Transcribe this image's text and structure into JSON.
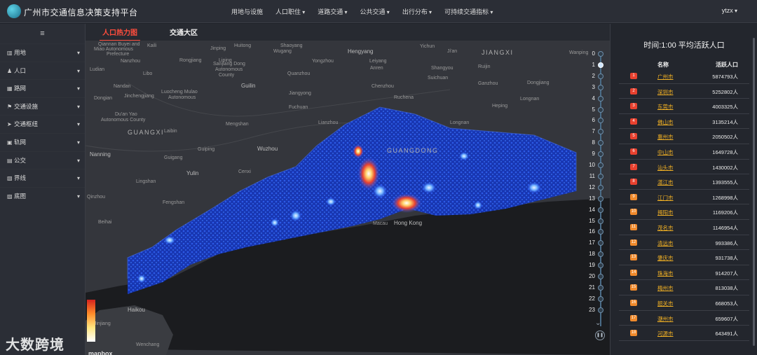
{
  "header": {
    "title": "广州市交通信息决策支持平台",
    "nav": [
      {
        "label": "用地与设施",
        "caret": false
      },
      {
        "label": "人口职住",
        "caret": true
      },
      {
        "label": "道路交通",
        "caret": true
      },
      {
        "label": "公共交通",
        "caret": true
      },
      {
        "label": "出行分布",
        "caret": true
      },
      {
        "label": "可持续交通指标",
        "caret": true
      }
    ],
    "user": "ytzx"
  },
  "sidebar": {
    "menu_icon": "menu-icon",
    "items": [
      {
        "label": "用地",
        "icon": "bar-chart-icon",
        "glyph": "▥"
      },
      {
        "label": "人口",
        "icon": "user-icon",
        "glyph": "♟"
      },
      {
        "label": "路网",
        "icon": "road-icon",
        "glyph": "▦"
      },
      {
        "label": "交通设施",
        "icon": "signpost-icon",
        "glyph": "⚑"
      },
      {
        "label": "交通枢纽",
        "icon": "navigation-icon",
        "glyph": "➤"
      },
      {
        "label": "轨网",
        "icon": "train-icon",
        "glyph": "▣"
      },
      {
        "label": "公交",
        "icon": "bus-icon",
        "glyph": "▤"
      },
      {
        "label": "界线",
        "icon": "boundary-icon",
        "glyph": "▧"
      },
      {
        "label": "底图",
        "icon": "basemap-icon",
        "glyph": "▨"
      }
    ]
  },
  "tabs": [
    {
      "label": "人口热力图",
      "active": true
    },
    {
      "label": "交通大区",
      "active": false
    }
  ],
  "map": {
    "labels": [
      {
        "text": "Qiannan Buyei and",
        "cls": ""
      },
      {
        "text": "Miao Autonomous",
        "cls": ""
      },
      {
        "text": "Prefecture",
        "cls": ""
      },
      {
        "text": "Kaili",
        "cls": ""
      },
      {
        "text": "Jinping",
        "cls": ""
      },
      {
        "text": "Huitong",
        "cls": ""
      },
      {
        "text": "Shaoyang",
        "cls": ""
      },
      {
        "text": "Wugang",
        "cls": ""
      },
      {
        "text": "Hengyang",
        "cls": "mid"
      },
      {
        "text": "Yichun",
        "cls": ""
      },
      {
        "text": "Ji'an",
        "cls": ""
      },
      {
        "text": "JIANGXI",
        "cls": "big"
      },
      {
        "text": "Wanping",
        "cls": ""
      },
      {
        "text": "Nanzhou",
        "cls": ""
      },
      {
        "text": "Rongjiang",
        "cls": ""
      },
      {
        "text": "Liping",
        "cls": ""
      },
      {
        "text": "Yongzhou",
        "cls": ""
      },
      {
        "text": "Leiyang",
        "cls": ""
      },
      {
        "text": "Anren",
        "cls": ""
      },
      {
        "text": "Shangyou",
        "cls": ""
      },
      {
        "text": "Ruijin",
        "cls": ""
      },
      {
        "text": "Ludian",
        "cls": ""
      },
      {
        "text": "Libo",
        "cls": ""
      },
      {
        "text": "Sanjiang Dong",
        "cls": ""
      },
      {
        "text": "Autonomous",
        "cls": ""
      },
      {
        "text": "County",
        "cls": ""
      },
      {
        "text": "Quanzhou",
        "cls": ""
      },
      {
        "text": "Guilin",
        "cls": "mid"
      },
      {
        "text": "Chenzhou",
        "cls": ""
      },
      {
        "text": "Suichuan",
        "cls": ""
      },
      {
        "text": "Ganzhou",
        "cls": ""
      },
      {
        "text": "Nandan",
        "cls": ""
      },
      {
        "text": "Luocheng Mulao",
        "cls": ""
      },
      {
        "text": "Jiangyong",
        "cls": ""
      },
      {
        "text": "Dongjiang",
        "cls": ""
      },
      {
        "text": "Longnan",
        "cls": ""
      },
      {
        "text": "Dongian",
        "cls": ""
      },
      {
        "text": "Jinchengjiang",
        "cls": ""
      },
      {
        "text": "Autonomous",
        "cls": ""
      },
      {
        "text": "Fuchuan",
        "cls": ""
      },
      {
        "text": "Ruchena",
        "cls": ""
      },
      {
        "text": "Heping",
        "cls": ""
      },
      {
        "text": "Du'an Yao",
        "cls": ""
      },
      {
        "text": "Autonomous County",
        "cls": ""
      },
      {
        "text": "Mengshan",
        "cls": ""
      },
      {
        "text": "Lianzhou",
        "cls": ""
      },
      {
        "text": "Longnan",
        "cls": ""
      },
      {
        "text": "GUANGXI",
        "cls": "big"
      },
      {
        "text": "Laibin",
        "cls": ""
      },
      {
        "text": "GUANGDONG",
        "cls": "big"
      },
      {
        "text": "Nanning",
        "cls": "mid"
      },
      {
        "text": "Guiping",
        "cls": ""
      },
      {
        "text": "Wuzhou",
        "cls": "mid"
      },
      {
        "text": "Guigang",
        "cls": ""
      },
      {
        "text": "Yulin",
        "cls": "mid"
      },
      {
        "text": "Cenxi",
        "cls": ""
      },
      {
        "text": "Lingshan",
        "cls": ""
      },
      {
        "text": "Qinzhou",
        "cls": ""
      },
      {
        "text": "Fengshan",
        "cls": ""
      },
      {
        "text": "Beihai",
        "cls": ""
      },
      {
        "text": "Macau",
        "cls": ""
      },
      {
        "text": "Hong Kong",
        "cls": "mid"
      },
      {
        "text": "Haikou",
        "cls": "mid"
      },
      {
        "text": "Jinjiang",
        "cls": ""
      },
      {
        "text": "Wenchang",
        "cls": ""
      }
    ],
    "hours": [
      "0",
      "1",
      "2",
      "3",
      "4",
      "5",
      "6",
      "7",
      "8",
      "9",
      "10",
      "11",
      "12",
      "13",
      "14",
      "15",
      "16",
      "17",
      "18",
      "19",
      "20",
      "21",
      "22",
      "23"
    ],
    "mapbox": "mapbox",
    "watermark": "大数跨境"
  },
  "ranking": {
    "title": "时间:1:00  平均活跃人口",
    "col_name": "名称",
    "col_value": "活跃人口",
    "rows": [
      {
        "rank": "1",
        "city": "广州市",
        "value": "5874793人"
      },
      {
        "rank": "2",
        "city": "深圳市",
        "value": "5252802人"
      },
      {
        "rank": "3",
        "city": "东莞市",
        "value": "4003325人"
      },
      {
        "rank": "4",
        "city": "佛山市",
        "value": "3135214人"
      },
      {
        "rank": "5",
        "city": "惠州市",
        "value": "2050502人"
      },
      {
        "rank": "6",
        "city": "中山市",
        "value": "1649728人"
      },
      {
        "rank": "7",
        "city": "汕头市",
        "value": "1430002人"
      },
      {
        "rank": "8",
        "city": "湛江市",
        "value": "1393555人"
      },
      {
        "rank": "9",
        "city": "江门市",
        "value": "1268998人"
      },
      {
        "rank": "10",
        "city": "揭阳市",
        "value": "1169206人"
      },
      {
        "rank": "11",
        "city": "茂名市",
        "value": "1146954人"
      },
      {
        "rank": "12",
        "city": "清远市",
        "value": "993386人"
      },
      {
        "rank": "13",
        "city": "肇庆市",
        "value": "931738人"
      },
      {
        "rank": "14",
        "city": "珠海市",
        "value": "914207人"
      },
      {
        "rank": "15",
        "city": "梅州市",
        "value": "813038人"
      },
      {
        "rank": "16",
        "city": "韶关市",
        "value": "668053人"
      },
      {
        "rank": "17",
        "city": "潮州市",
        "value": "659607人"
      },
      {
        "rank": "18",
        "city": "河源市",
        "value": "643491人"
      }
    ],
    "colors": {
      "top": "#e8412f",
      "rest": "#f08a2c"
    }
  }
}
